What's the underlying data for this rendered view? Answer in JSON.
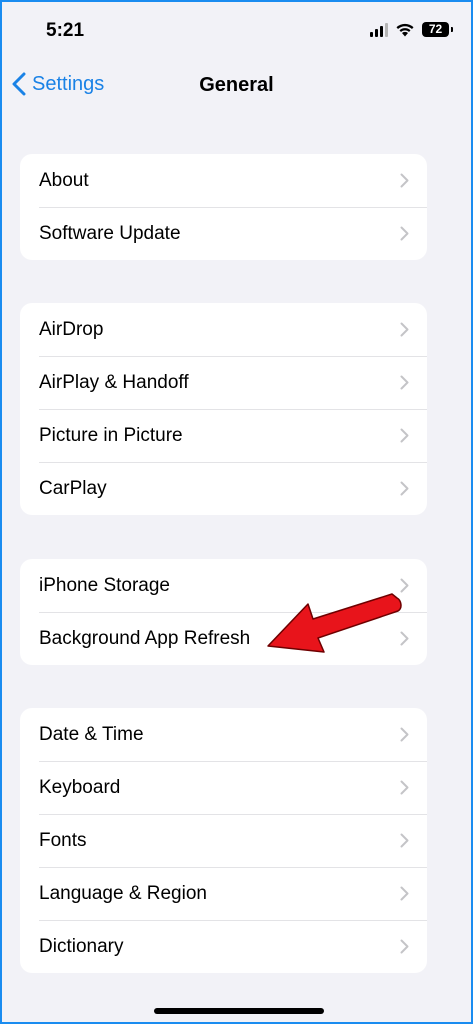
{
  "status_bar": {
    "time": "5:21",
    "battery": "72",
    "icons": [
      "signal-icon",
      "wifi-icon",
      "battery-icon"
    ]
  },
  "nav": {
    "back_label": "Settings",
    "title": "General"
  },
  "groups": [
    {
      "items": [
        {
          "label": "About"
        },
        {
          "label": "Software Update"
        }
      ]
    },
    {
      "items": [
        {
          "label": "AirDrop"
        },
        {
          "label": "AirPlay & Handoff"
        },
        {
          "label": "Picture in Picture"
        },
        {
          "label": "CarPlay"
        }
      ]
    },
    {
      "items": [
        {
          "label": "iPhone Storage"
        },
        {
          "label": "Background App Refresh"
        }
      ]
    },
    {
      "items": [
        {
          "label": "Date & Time"
        },
        {
          "label": "Keyboard"
        },
        {
          "label": "Fonts"
        },
        {
          "label": "Language & Region"
        },
        {
          "label": "Dictionary"
        }
      ]
    }
  ],
  "annotation": {
    "icon": "red-arrow-icon",
    "color": "#e8141b",
    "points_to": "Background App Refresh"
  },
  "colors": {
    "accent": "#1a82e6",
    "background": "#f2f2f7",
    "frame_border": "#1a8cf0"
  }
}
